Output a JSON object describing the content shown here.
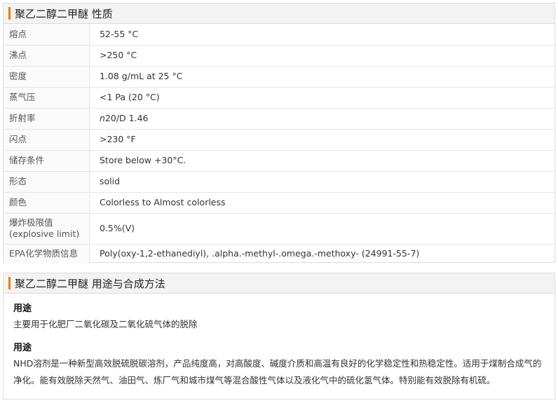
{
  "properties_section": {
    "title": "聚乙二醇二甲醚 性质",
    "rows": [
      {
        "label": "熔点",
        "value": "52-55 °C"
      },
      {
        "label": "沸点",
        "value": ">250 °C"
      },
      {
        "label": "密度",
        "value": "1.08 g/mL at 25 °C"
      },
      {
        "label": "蒸气压",
        "value": "<1 Pa (20 °C)"
      },
      {
        "label": "折射率",
        "value_italic": "n",
        "value": "20/D 1.46"
      },
      {
        "label": "闪点",
        "value": ">230 °F"
      },
      {
        "label": "储存条件",
        "value": "Store below +30°C."
      },
      {
        "label": "形态",
        "value": "solid"
      },
      {
        "label": "颜色",
        "value": "Colorless to Almost colorless"
      },
      {
        "label": "爆炸极限值(explosive limit)",
        "value": "0.5%(V)"
      },
      {
        "label": "EPA化学物质信息",
        "value": "Poly(oxy-1,2-ethanediyl), .alpha.-methyl-.omega.-methoxy- (24991-55-7)"
      }
    ]
  },
  "uses_section": {
    "title": "聚乙二醇二甲醚 用途与合成方法",
    "blocks": [
      {
        "heading": "用途",
        "text": "主要用于化肥厂二氧化碳及二氧化硫气体的脱除"
      },
      {
        "heading": "用途",
        "text": "NHD溶剂是一种新型高效脱硫脱碳溶剂，产品纯度高，对高酸度、碱度介质和高温有良好的化学稳定性和热稳定性。适用于煤制合成气的净化。能有效脱除天然气、油田气、炼厂气和城市煤气等混合酸性气体以及液化气中的硫化氢气体。特别能有效脱除有机硫。"
      }
    ]
  },
  "colors": {
    "accent": "#f07c00",
    "header_bg": "#f3f3f3",
    "link": "#1a5fa8",
    "border": "#dcdcdc"
  }
}
